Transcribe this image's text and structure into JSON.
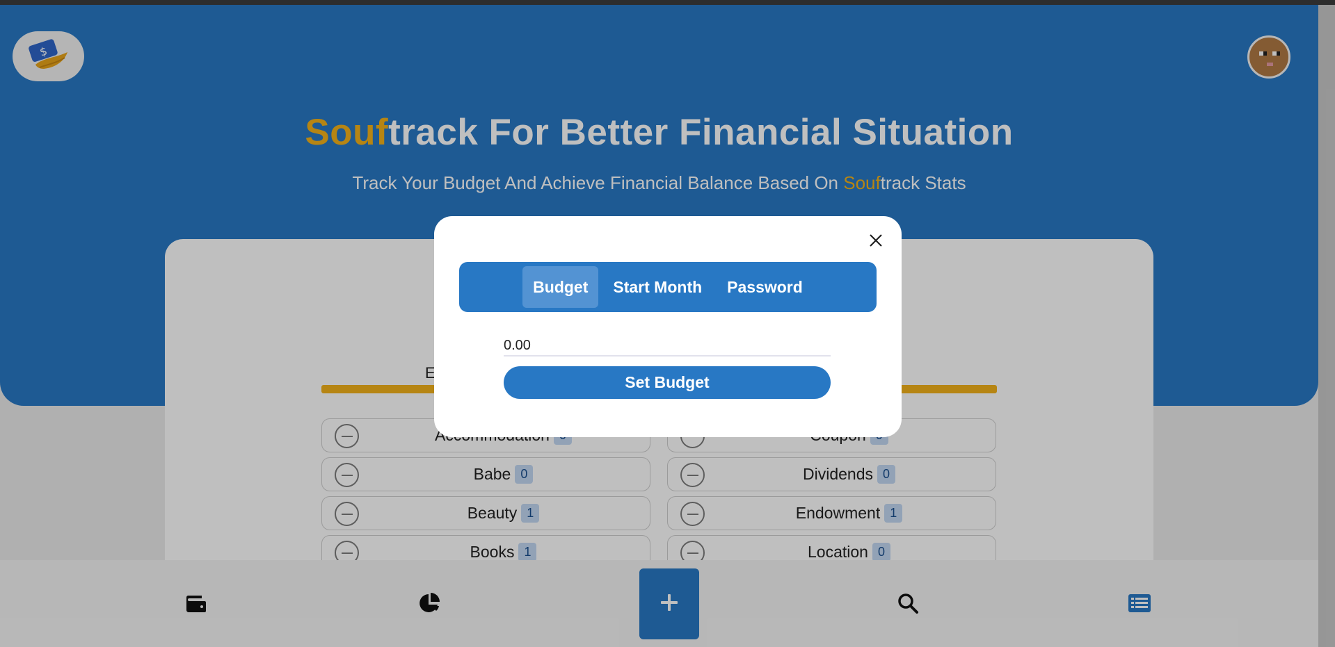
{
  "header": {
    "logo_icon": "money-hand-icon",
    "avatar_icon": "pixel-avatar",
    "title_accent": "Souf",
    "title_rest": "track For Better Financial Situation",
    "subtitle_before": "Track Your Budget And Achieve Financial Balance Based On ",
    "subtitle_accent": "Souf",
    "subtitle_after": "track Stats"
  },
  "card": {
    "tab_label": "E",
    "left_column": [
      {
        "label": "Accommodation",
        "count": "0"
      },
      {
        "label": "Babe",
        "count": "0"
      },
      {
        "label": "Beauty",
        "count": "1"
      },
      {
        "label": "Books",
        "count": "1"
      }
    ],
    "right_column": [
      {
        "label": "Coupon",
        "count": "0"
      },
      {
        "label": "Dividends",
        "count": "0"
      },
      {
        "label": "Endowment",
        "count": "1"
      },
      {
        "label": "Location",
        "count": "0"
      }
    ]
  },
  "modal": {
    "close_icon": "close-icon",
    "tabs": [
      {
        "label": "Budget",
        "active": true
      },
      {
        "label": "Start Month",
        "active": false
      },
      {
        "label": "Password",
        "active": false
      }
    ],
    "budget_value": "0.00",
    "submit_label": "Set Budget"
  },
  "bottom_nav": {
    "items": [
      "wallet-icon",
      "pie-chart-icon",
      "plus-icon",
      "search-icon",
      "list-icon"
    ]
  },
  "colors": {
    "primary": "#2878c4",
    "accent": "#f3b21a",
    "badge_bg": "#c3d9f3"
  }
}
